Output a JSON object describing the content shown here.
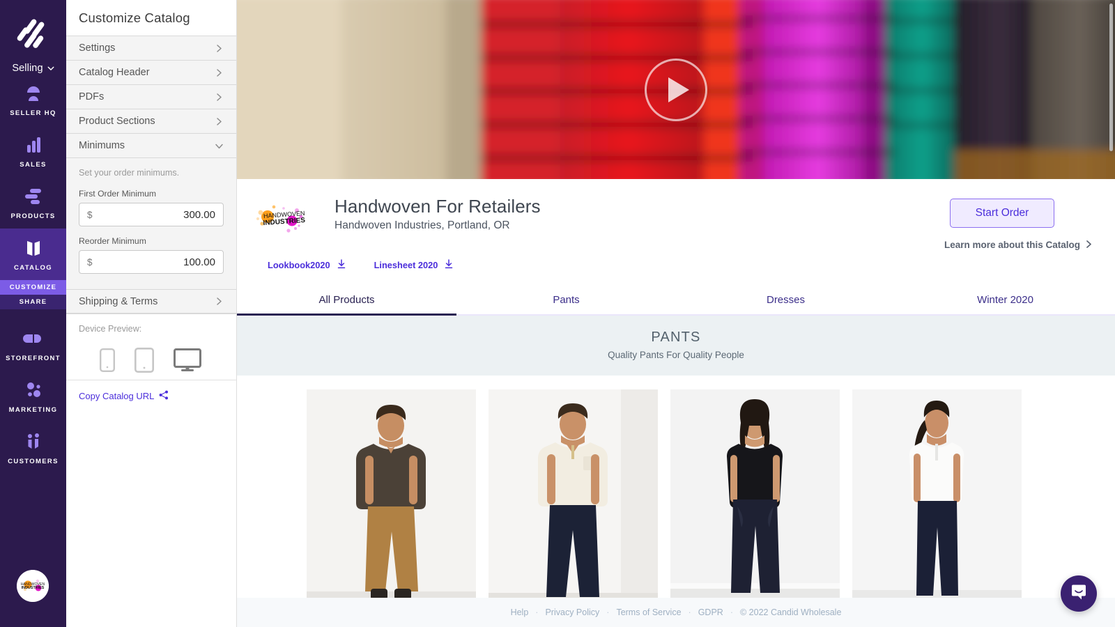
{
  "rail": {
    "logo_icon": "candid-logo-icon",
    "account_switcher": {
      "label": "Selling",
      "icon": "chevron-down-icon"
    },
    "items": [
      {
        "label": "SELLER HQ",
        "icon": "seller-hq-icon",
        "active": false
      },
      {
        "label": "SALES",
        "icon": "bar-chart-icon",
        "active": false
      },
      {
        "label": "PRODUCTS",
        "icon": "products-icon",
        "active": false
      },
      {
        "label": "CATALOG",
        "icon": "catalog-icon",
        "active": true
      },
      {
        "label": "STOREFRONT",
        "icon": "storefront-icon",
        "active": false
      },
      {
        "label": "MARKETING",
        "icon": "marketing-icon",
        "active": false
      },
      {
        "label": "CUSTOMERS",
        "icon": "customers-icon",
        "active": false
      }
    ],
    "catalog_subitems": [
      {
        "label": "CUSTOMIZE",
        "selected": true
      },
      {
        "label": "SHARE",
        "selected": false
      }
    ],
    "avatar_name": "handwoven-industries-avatar",
    "bg_color": "#2C1A4D",
    "active_color": "#4A2C8F",
    "subitem_color": "#7C5CE6"
  },
  "panel": {
    "title": "Customize Catalog",
    "accordions": [
      {
        "label": "Settings",
        "icon": "chevron-right-icon",
        "expanded": false
      },
      {
        "label": "Catalog Header",
        "icon": "chevron-right-icon",
        "expanded": false
      },
      {
        "label": "PDFs",
        "icon": "chevron-right-icon",
        "expanded": false
      },
      {
        "label": "Product Sections",
        "icon": "chevron-right-icon",
        "expanded": false
      },
      {
        "label": "Minimums",
        "icon": "chevron-down-icon",
        "expanded": true
      }
    ],
    "minimums": {
      "hint": "Set your order minimums.",
      "first_order": {
        "label": "First Order Minimum",
        "currency": "$",
        "value": "300.00"
      },
      "reorder": {
        "label": "Reorder Minimum",
        "currency": "$",
        "value": "100.00"
      }
    },
    "shipping_terms": {
      "label": "Shipping & Terms",
      "icon": "chevron-right-icon"
    },
    "device_preview": {
      "label": "Device Preview:",
      "options": [
        {
          "name": "phone-icon",
          "selected": false
        },
        {
          "name": "tablet-icon",
          "selected": false
        },
        {
          "name": "desktop-icon",
          "selected": true
        }
      ]
    },
    "copy_url": {
      "label": "Copy Catalog URL",
      "icon": "share-icon",
      "color": "#4B2EDB"
    }
  },
  "hero": {
    "play_button_icon": "play-icon",
    "alt": "blurred rack of colorful puffer jackets"
  },
  "catalog": {
    "brand_logo_name": "handwoven-industries-logo",
    "title": "Handwoven For Retailers",
    "subtitle": "Handwoven Industries, Portland, OR",
    "pdf_links": [
      {
        "label": "Lookbook2020",
        "icon": "download-icon"
      },
      {
        "label": "Linesheet 2020",
        "icon": "download-icon"
      }
    ],
    "start_order_label": "Start Order",
    "learn_more_label": "Learn more about this Catalog",
    "learn_more_icon": "chevron-right-icon",
    "accent_color": "#4B2EDB"
  },
  "tabs": [
    {
      "label": "All Products",
      "active": true
    },
    {
      "label": "Pants",
      "active": false
    },
    {
      "label": "Dresses",
      "active": false
    },
    {
      "label": "Winter 2020",
      "active": false
    }
  ],
  "section": {
    "name": "PANTS",
    "description": "Quality Pants For Quality People",
    "bg_color": "#ECF1F3"
  },
  "products": [
    {
      "name": "product-card-1",
      "alt": "man in brown v-neck tee and tan chino pants"
    },
    {
      "name": "product-card-2",
      "alt": "man in cream polo and navy trousers"
    },
    {
      "name": "product-card-3",
      "alt": "woman in black tank and navy slouch pants"
    },
    {
      "name": "product-card-4",
      "alt": "woman in white sleeveless shirt and navy slim pants"
    }
  ],
  "footer": {
    "links": [
      "Help",
      "Privacy Policy",
      "Terms of Service",
      "GDPR"
    ],
    "separator": "·",
    "copyright": "© 2022 Candid Wholesale"
  },
  "intercom": {
    "icon": "intercom-chat-icon",
    "color": "#3A2171"
  }
}
